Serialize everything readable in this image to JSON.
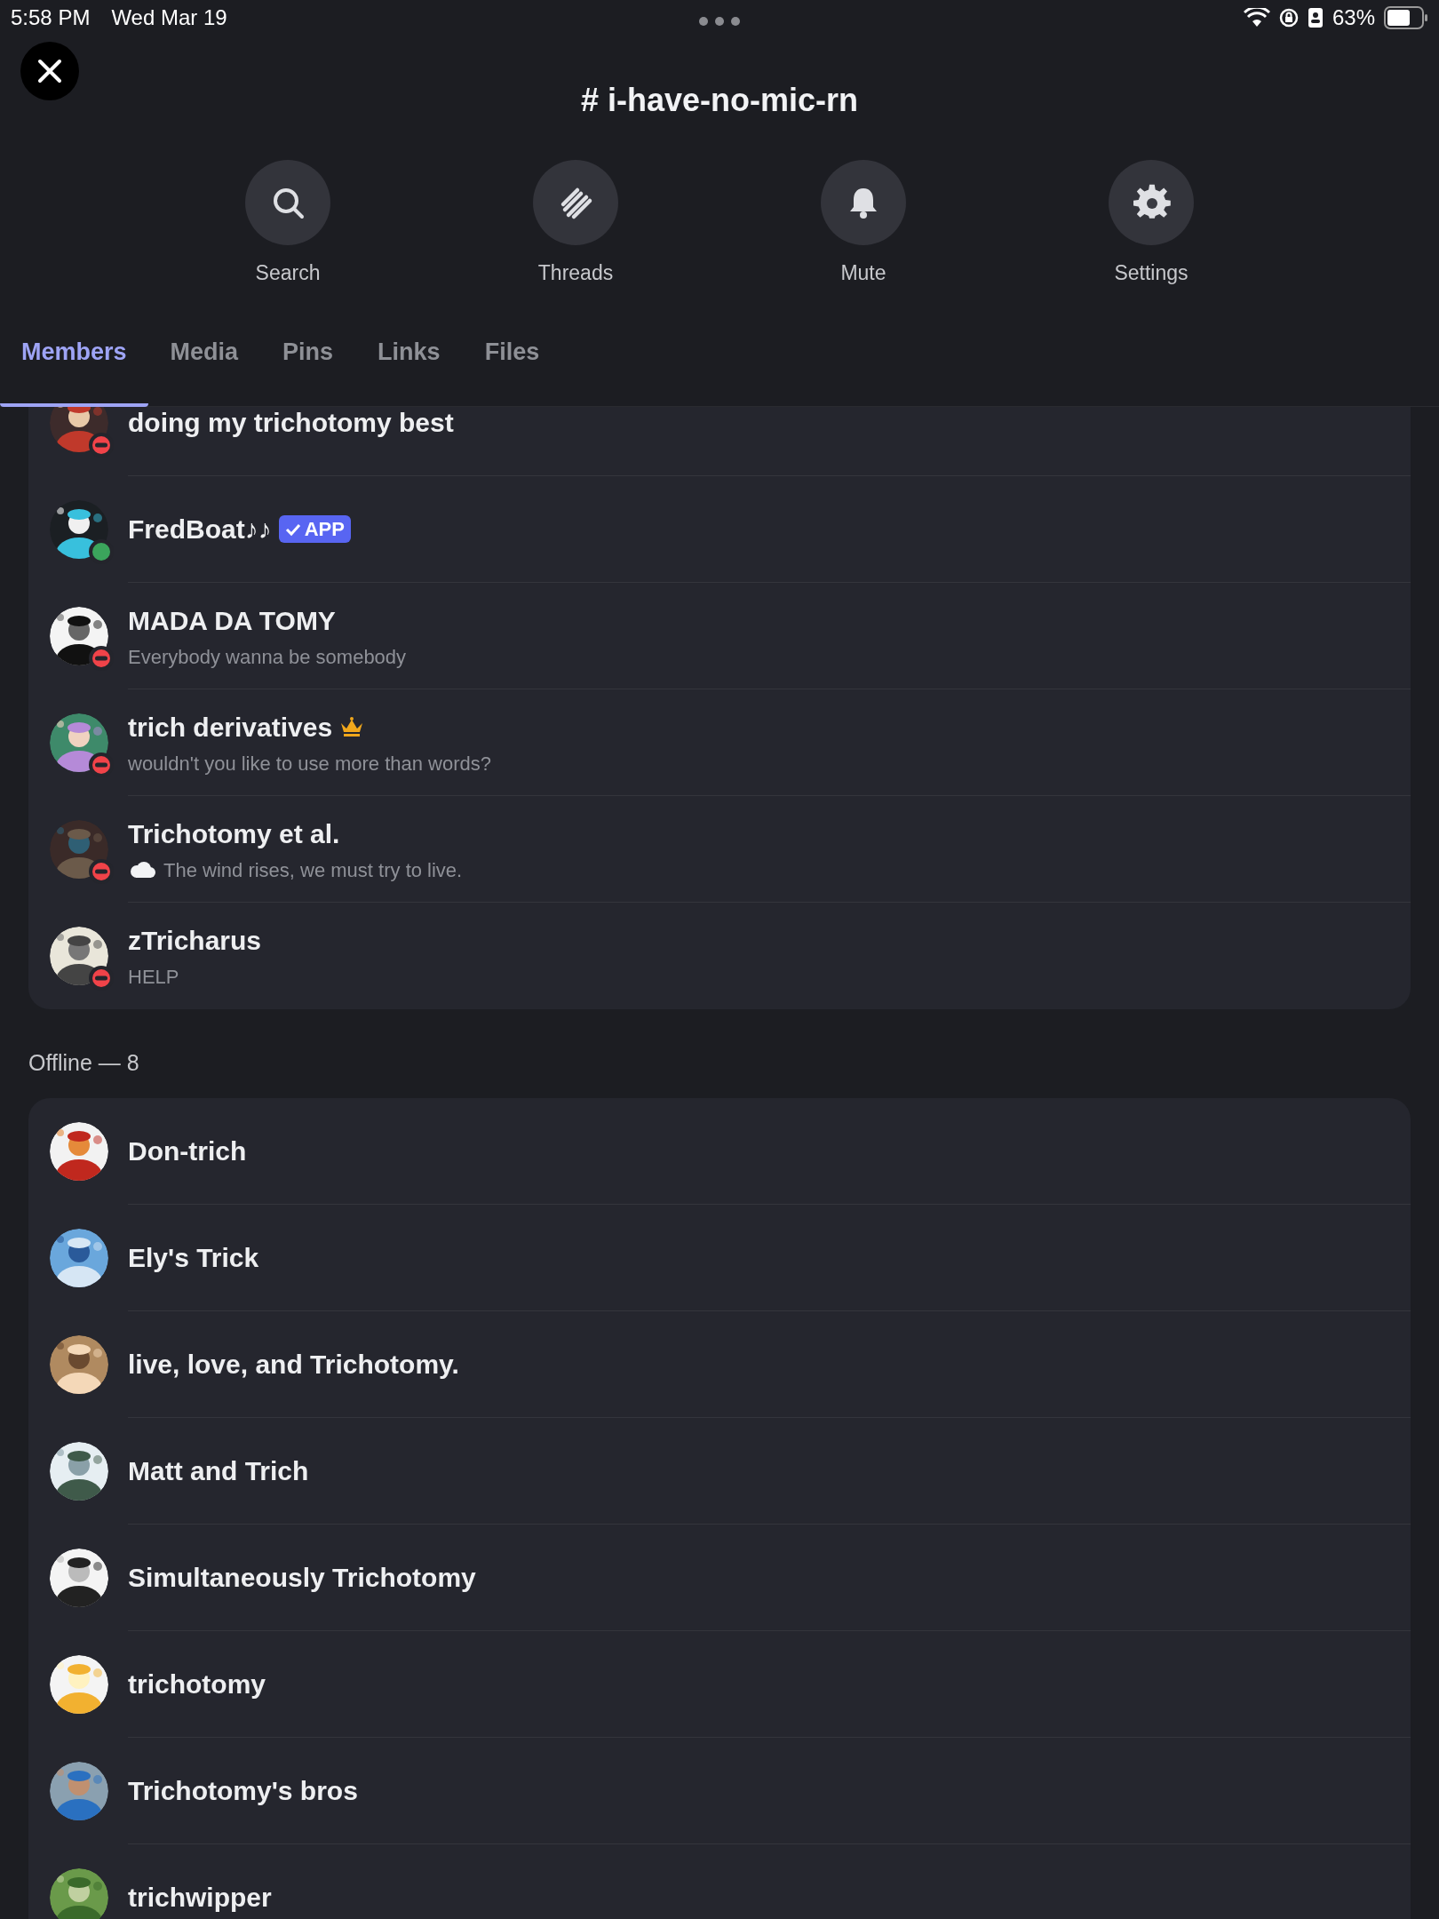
{
  "status_bar": {
    "time": "5:58 PM",
    "date": "Wed Mar 19",
    "battery_text": "63%"
  },
  "header": {
    "title": "# i-have-no-mic-rn"
  },
  "actions": [
    {
      "label": "Search",
      "kind": "search"
    },
    {
      "label": "Threads",
      "kind": "threads"
    },
    {
      "label": "Mute",
      "kind": "bell"
    },
    {
      "label": "Settings",
      "kind": "gear"
    }
  ],
  "tabs": [
    {
      "label": "Members",
      "selected": true
    },
    {
      "label": "Media",
      "selected": false
    },
    {
      "label": "Pins",
      "selected": false
    },
    {
      "label": "Links",
      "selected": false
    },
    {
      "label": "Files",
      "selected": false
    }
  ],
  "groups": [
    {
      "members": [
        {
          "name": "doing my trichotomy best",
          "online": false,
          "do_not_disturb": true
        },
        {
          "name": "FredBoat♪♪",
          "online": true,
          "do_not_disturb": false,
          "badge": {
            "kind": "app",
            "label": "APP"
          }
        },
        {
          "name": "MADA DA TOMY",
          "online": false,
          "do_not_disturb": true,
          "subtitle": "Everybody wanna be somebody"
        },
        {
          "name": "trich derivatives",
          "online": false,
          "do_not_disturb": true,
          "badge": {
            "kind": "crown"
          },
          "subtitle": "wouldn't you like to use more than words?"
        },
        {
          "name": "Trichotomy et al.",
          "online": false,
          "do_not_disturb": true,
          "subtitle": "The wind rises, we must try to live.",
          "cloud_icon": true
        },
        {
          "name": "zTricharus",
          "online": false,
          "do_not_disturb": true,
          "subtitle": "HELP"
        }
      ]
    },
    {
      "heading": "Offline — 8",
      "members": [
        {
          "name": "Don-trich",
          "online": false,
          "do_not_disturb": false
        },
        {
          "name": "Ely's Trick",
          "online": false,
          "do_not_disturb": false
        },
        {
          "name": "live, love, and Trichotomy.",
          "online": false,
          "do_not_disturb": false
        },
        {
          "name": "Matt and Trich",
          "online": false,
          "do_not_disturb": false
        },
        {
          "name": "Simultaneously Trichotomy",
          "online": false,
          "do_not_disturb": false
        },
        {
          "name": "trichotomy",
          "online": false,
          "do_not_disturb": false
        },
        {
          "name": "Trichotomy's bros",
          "online": false,
          "do_not_disturb": false
        },
        {
          "name": "trichwipper",
          "online": false,
          "do_not_disturb": false
        }
      ]
    }
  ]
}
